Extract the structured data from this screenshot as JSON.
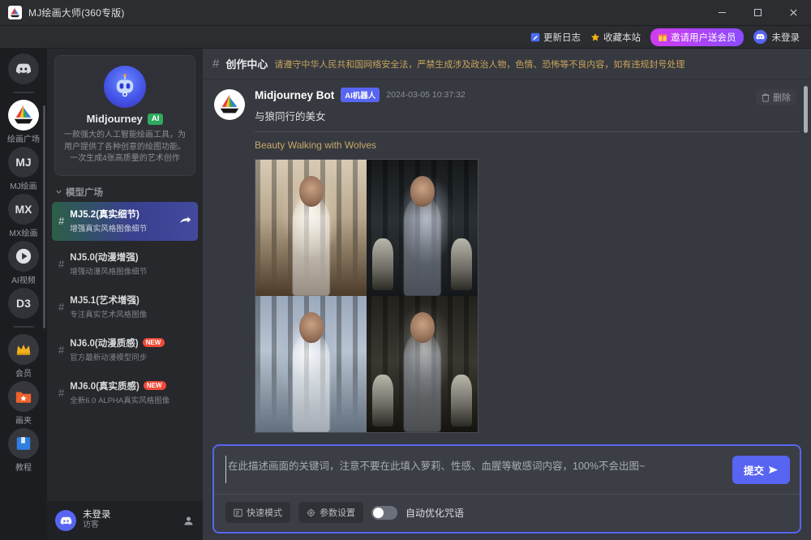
{
  "window": {
    "title": "MJ绘画大师(360专版)",
    "app_icon": "sailboat-icon",
    "minimize": "─",
    "maximize": "□",
    "close": "✕"
  },
  "topnav": {
    "update_log": "更新日志",
    "bookmark": "收藏本站",
    "invite": "邀请用户送会员",
    "login_status": "未登录"
  },
  "rail": {
    "items": [
      {
        "label": "",
        "icon": "discord-icon",
        "id": "discord"
      },
      {
        "label": "绘画广场",
        "icon": "sailboat-icon",
        "id": "plaza"
      },
      {
        "label": "MJ绘画",
        "icon": "mj-text-icon",
        "id": "mj"
      },
      {
        "label": "MX绘画",
        "icon": "mx-text-icon",
        "id": "mx"
      },
      {
        "label": "AI视频",
        "icon": "play-icon",
        "id": "video"
      },
      {
        "label": "",
        "icon": "d3-text-icon",
        "id": "d3"
      },
      {
        "label": "会员",
        "icon": "crown-icon",
        "id": "vip"
      },
      {
        "label": "画夹",
        "icon": "folder-star-icon",
        "id": "gallery"
      },
      {
        "label": "教程",
        "icon": "book-icon",
        "id": "tutorial"
      }
    ]
  },
  "sidebar": {
    "promo": {
      "icon": "robot-icon",
      "title": "Midjourney",
      "badge": "AI",
      "description": "一款强大的人工智能绘画工具，为用户提供了各种创意的绘图功能。一次生成4张高质量的艺术创作"
    },
    "section_title": "模型广场",
    "models": [
      {
        "name": "MJ5.2(真实细节)",
        "sub": "增强真实风格图像细节",
        "badge": "",
        "active": true
      },
      {
        "name": "NJ5.0(动漫增强)",
        "sub": "增强动漫风格图像细节",
        "badge": "",
        "active": false
      },
      {
        "name": "MJ5.1(艺术增强)",
        "sub": "专注真实艺术风格图像",
        "badge": "",
        "active": false
      },
      {
        "name": "NJ6.0(动漫质感)",
        "sub": "官方最新动漫模型同步",
        "badge": "NEW",
        "active": false
      },
      {
        "name": "MJ6.0(真实质感)",
        "sub": "全新6.0 ALPHA真实风格图像",
        "badge": "NEW",
        "active": false
      }
    ],
    "user": {
      "name": "未登录",
      "role": "访客",
      "avatar_icon": "discord-icon",
      "action_icon": "person-icon"
    }
  },
  "main": {
    "header": {
      "hash": "#",
      "title": "创作中心",
      "notice": "请遵守中华人民共和国网络安全法，严禁生成涉及政治人物，色情、恐怖等不良内容，如有违规封号处理"
    },
    "message": {
      "avatar_icon": "sailboat-icon",
      "author": "Midjourney Bot",
      "badge": "AI机器人",
      "timestamp": "2024-03-05 10:37:32",
      "prompt_cn": "与狼同行的美女",
      "prompt_en": "Beauty Walking with Wolves",
      "delete_label": "删除",
      "delete_icon": "trash-icon"
    }
  },
  "composer": {
    "placeholder": "在此描述画面的关键词，注意不要在此填入萝莉、性感、血腥等敏感词内容，100%不会出图~",
    "value": "",
    "submit_label": "提交",
    "submit_icon": "send-arrow-icon",
    "fast_mode": "快速模式",
    "fast_mode_icon": "list-icon",
    "params": "参数设置",
    "params_icon": "gear-icon",
    "auto_optimize": "自动优化咒语",
    "auto_optimize_on": false
  },
  "colors": {
    "accent": "#5865f2",
    "invite_gradient_start": "#d23bf0",
    "invite_gradient_end": "#8a4bff",
    "badge_ai": "#2eaa5e",
    "badge_new": "#f04a38",
    "notice": "#c9a45c",
    "prompt_en": "#c8a86a"
  }
}
